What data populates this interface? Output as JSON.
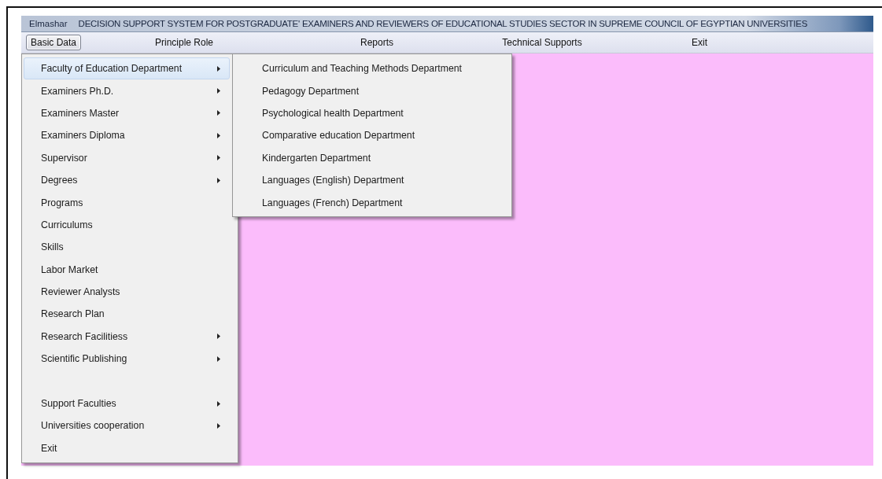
{
  "window": {
    "app_name": "Elmashar",
    "title": "DECISION SUPPORT SYSTEM FOR POSTGRADUATE' EXAMINERS AND REVIEWERS OF EDUCATIONAL STUDIES SECTOR IN SUPREME COUNCIL OF EGYPTIAN UNIVERSITIES"
  },
  "menu_bar": [
    {
      "label": "Basic Data",
      "selected": true
    },
    {
      "label": "Principle Role",
      "selected": false
    },
    {
      "label": "Reports",
      "selected": false
    },
    {
      "label": "Technical Supports",
      "selected": false
    },
    {
      "label": "Exit",
      "selected": false
    }
  ],
  "basic_data_menu": {
    "items": [
      {
        "kind": "submenu",
        "label": "Faculty of Education Department",
        "selected": true
      },
      {
        "kind": "submenu",
        "label": "Examiners Ph.D.",
        "selected": false
      },
      {
        "kind": "submenu",
        "label": "Examiners Master",
        "selected": false
      },
      {
        "kind": "submenu",
        "label": "Examiners Diploma",
        "selected": false
      },
      {
        "kind": "submenu",
        "label": "Supervisor",
        "selected": false
      },
      {
        "kind": "submenu",
        "label": "Degrees",
        "selected": false
      },
      {
        "kind": "command",
        "label": "Programs",
        "selected": false
      },
      {
        "kind": "command",
        "label": "Curriculums",
        "selected": false
      },
      {
        "kind": "command",
        "label": "Skills",
        "selected": false
      },
      {
        "kind": "command",
        "label": "Labor Market",
        "selected": false
      },
      {
        "kind": "command",
        "label": "Reviewer  Analysts",
        "selected": false
      },
      {
        "kind": "command",
        "label": "Research Plan",
        "selected": false
      },
      {
        "kind": "submenu",
        "label": "Research Facilitiess",
        "selected": false
      },
      {
        "kind": "submenu",
        "label": "Scientific Publishing",
        "selected": false
      },
      {
        "kind": "gap"
      },
      {
        "kind": "submenu",
        "label": "Support Faculties",
        "selected": false
      },
      {
        "kind": "submenu",
        "label": "Universities cooperation",
        "selected": false
      },
      {
        "kind": "command",
        "label": "Exit",
        "selected": false
      }
    ]
  },
  "department_submenu": {
    "items": [
      {
        "label": "Curriculum and Teaching Methods Department"
      },
      {
        "label": "Pedagogy Department"
      },
      {
        "label": "Psychological health Department"
      },
      {
        "label": "Comparative education Department"
      },
      {
        "label": "Kindergarten Department"
      },
      {
        "label": "Languages (English) Department"
      },
      {
        "label": "Languages (French) Department"
      }
    ]
  }
}
